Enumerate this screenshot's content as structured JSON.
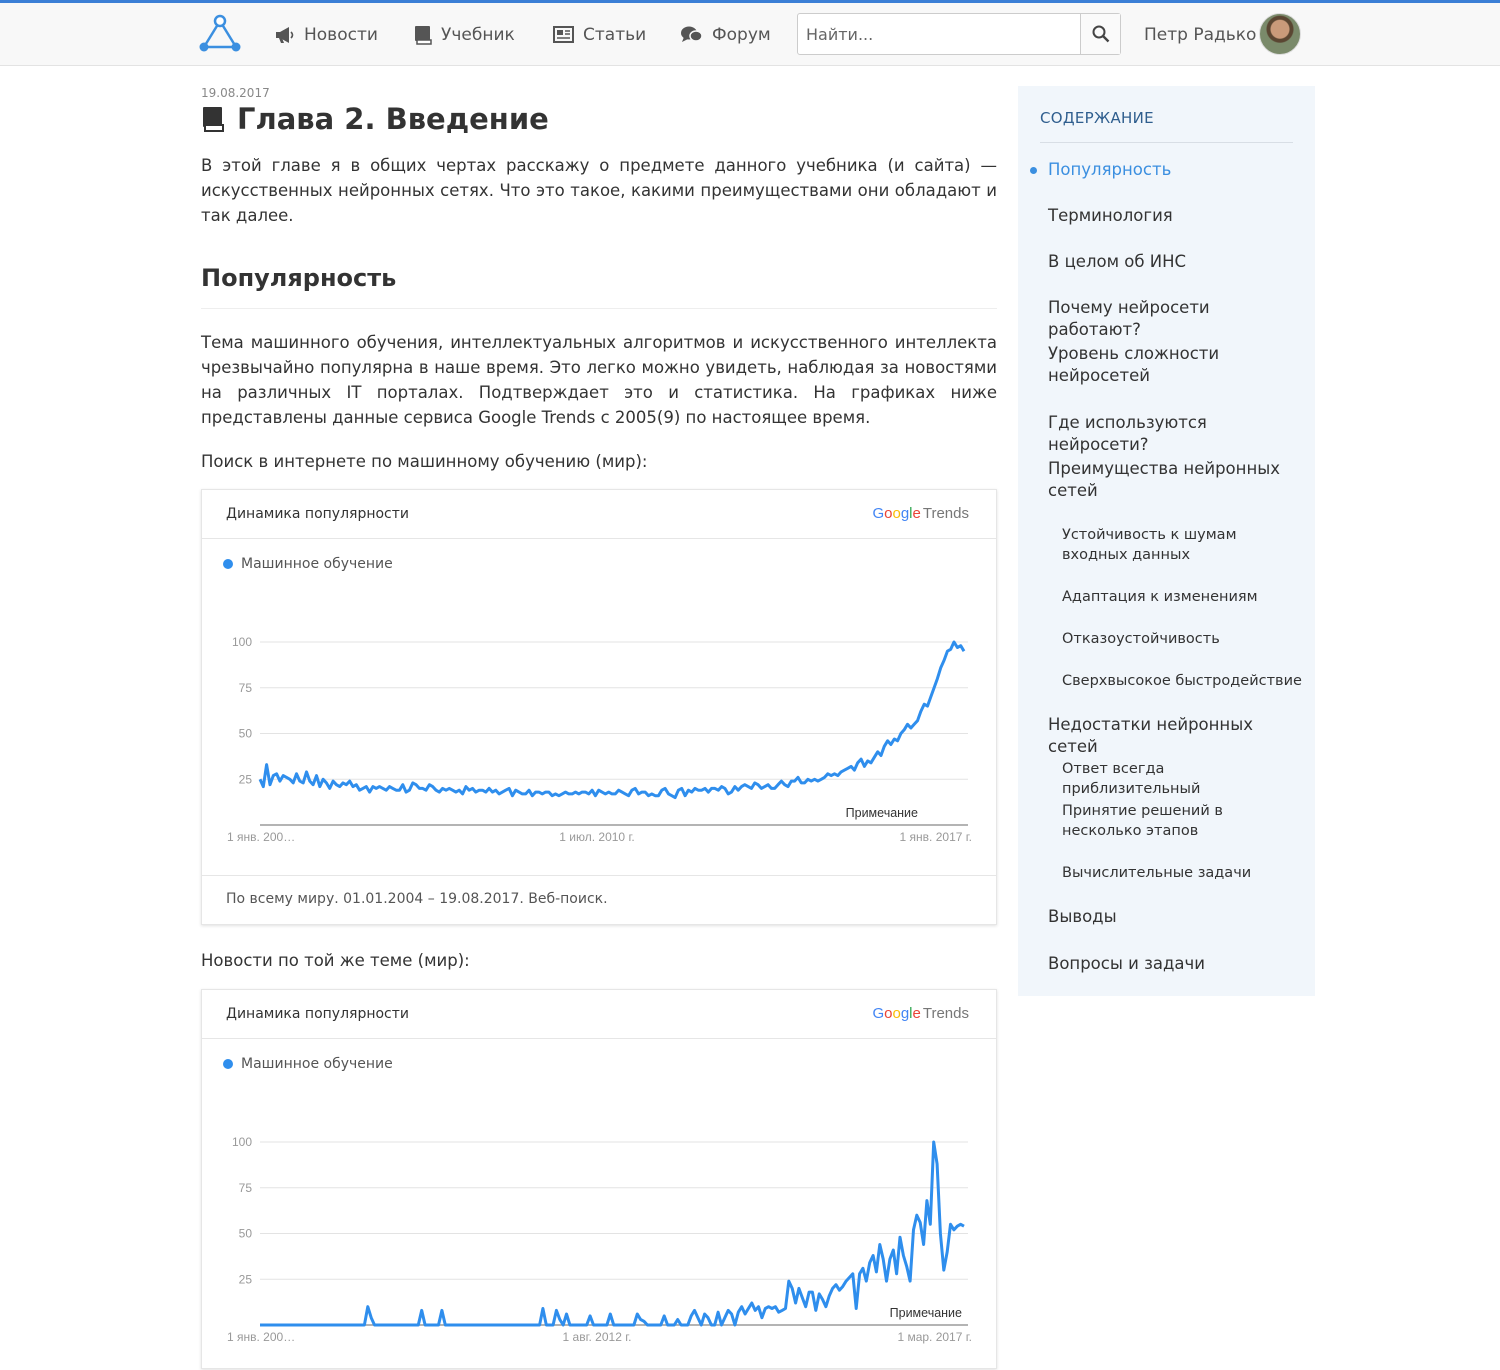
{
  "header": {
    "nav": [
      {
        "label": "Новости",
        "icon": "megaphone-icon"
      },
      {
        "label": "Учебник",
        "icon": "book-icon"
      },
      {
        "label": "Статьи",
        "icon": "newspaper-icon"
      },
      {
        "label": "Форум",
        "icon": "chat-bubbles-icon"
      }
    ],
    "search_placeholder": "Найти...",
    "user_name": "Петр Радько",
    "accent_color": "#3b7fd6"
  },
  "article": {
    "date": "19.08.2017",
    "title": "Глава 2. Введение",
    "intro": "В этой главе я в общих чертах расскажу о предмете данного учебника (и сайта) — искусственных нейронных сетях. Что это такое, какими преимуществами они обладают и так далее.",
    "section_title": "Популярность",
    "section_text": "Тема машинного обучения, интеллектуальных алгоритмов и искусственного интеллекта чрезвычайно популярна в наше время. Это легко можно увидеть, наблюдая за новостями на различных IT порталах. Подтверждает это и статистика. На графиках ниже представлены данные сервиса Google Trends с 2005(9) по настоящее время.",
    "caption1": "Поиск в интернете по машинному обучению (мир):",
    "caption2": "Новости по той же теме (мир):"
  },
  "trends_brand": {
    "google": [
      "G",
      "o",
      "o",
      "g",
      "l",
      "e"
    ],
    "trends": "Trends"
  },
  "chart_data": [
    {
      "type": "line",
      "card_title": "Динамика популярности",
      "series": [
        {
          "name": "Машинное обучение",
          "color": "#2f8eed",
          "values": [
            25,
            21,
            33,
            22,
            27,
            28,
            24,
            27,
            26,
            25,
            23,
            28,
            24,
            23,
            29,
            24,
            22,
            27,
            21,
            25,
            23,
            20,
            24,
            22,
            21,
            23,
            22,
            24,
            21,
            22,
            19,
            20,
            21,
            18,
            21,
            20,
            21,
            20,
            19,
            21,
            20,
            19,
            19,
            22,
            18,
            19,
            23,
            22,
            20,
            20,
            19,
            22,
            21,
            19,
            18,
            20,
            19,
            20,
            19,
            18,
            19,
            17,
            21,
            19,
            20,
            18,
            19,
            19,
            18,
            20,
            18,
            19,
            17,
            18,
            19,
            20,
            16,
            19,
            18,
            17,
            17,
            19,
            16,
            18,
            18,
            17,
            18,
            18,
            16,
            17,
            16,
            17,
            18,
            17,
            17,
            18,
            17,
            18,
            18,
            17,
            19,
            16,
            19,
            18,
            17,
            18,
            17,
            17,
            19,
            18,
            17,
            16,
            19,
            20,
            17,
            18,
            18,
            16,
            17,
            16,
            16,
            19,
            20,
            17,
            16,
            15,
            19,
            20,
            16,
            19,
            18,
            20,
            19,
            19,
            20,
            18,
            20,
            20,
            19,
            21,
            20,
            17,
            18,
            21,
            19,
            21,
            22,
            21,
            20,
            23,
            22,
            20,
            21,
            22,
            20,
            20,
            22,
            24,
            22,
            21,
            24,
            24,
            26,
            23,
            23,
            25,
            24,
            25,
            24,
            25,
            26,
            28,
            27,
            28,
            27,
            29,
            30,
            31,
            32,
            30,
            34,
            36,
            32,
            35,
            34,
            37,
            40,
            38,
            43,
            46,
            44,
            47,
            46,
            50,
            52,
            55,
            53,
            55,
            57,
            62,
            66,
            65,
            70,
            75,
            80,
            86,
            90,
            95,
            96,
            100,
            97,
            98,
            95
          ]
        }
      ],
      "yticks": [
        25,
        50,
        75,
        100
      ],
      "ylim": [
        0,
        100
      ],
      "x_tick_labels": [
        "1 янв. 200…",
        "1 июл. 2010 г.",
        "1 янв. 2017 г."
      ],
      "note": "Примечание",
      "footer": "По всему миру. 01.01.2004 – 19.08.2017. Веб-поиск."
    },
    {
      "type": "line",
      "card_title": "Динамика популярности",
      "series": [
        {
          "name": "Машинное обучение",
          "color": "#2f8eed",
          "values": [
            0,
            0,
            0,
            0,
            0,
            0,
            0,
            0,
            0,
            0,
            0,
            0,
            0,
            0,
            0,
            0,
            0,
            0,
            0,
            0,
            0,
            0,
            0,
            0,
            0,
            0,
            0,
            0,
            0,
            0,
            0,
            0,
            10,
            4,
            0,
            0,
            0,
            0,
            0,
            0,
            0,
            0,
            0,
            0,
            0,
            0,
            0,
            0,
            8,
            0,
            0,
            0,
            0,
            0,
            8,
            0,
            0,
            0,
            0,
            0,
            0,
            0,
            0,
            0,
            0,
            0,
            0,
            0,
            0,
            0,
            0,
            0,
            0,
            0,
            0,
            0,
            0,
            0,
            0,
            0,
            0,
            0,
            0,
            0,
            9,
            0,
            0,
            0,
            8,
            3,
            0,
            6,
            0,
            0,
            0,
            0,
            0,
            0,
            5,
            0,
            0,
            0,
            0,
            0,
            6,
            0,
            0,
            0,
            0,
            0,
            0,
            0,
            6,
            3,
            2,
            0,
            0,
            0,
            0,
            0,
            5,
            0,
            0,
            0,
            3,
            0,
            0,
            0,
            5,
            8,
            4,
            0,
            6,
            4,
            0,
            0,
            7,
            0,
            4,
            8,
            6,
            0,
            7,
            10,
            6,
            9,
            12,
            8,
            10,
            4,
            9,
            10,
            9,
            10,
            7,
            8,
            9,
            24,
            20,
            12,
            20,
            15,
            10,
            18,
            18,
            8,
            17,
            14,
            10,
            16,
            20,
            22,
            19,
            21,
            24,
            26,
            28,
            9,
            28,
            31,
            24,
            34,
            38,
            29,
            44,
            36,
            24,
            36,
            41,
            28,
            48,
            38,
            32,
            24,
            52,
            60,
            56,
            44,
            68,
            55,
            100,
            88,
            50,
            30,
            40,
            55,
            52,
            54,
            55,
            54
          ]
        }
      ],
      "yticks": [
        25,
        50,
        75,
        100
      ],
      "ylim": [
        0,
        100
      ],
      "x_tick_labels": [
        "1 янв. 200…",
        "1 авг. 2012 г.",
        "1 мар. 2017 г."
      ],
      "note": "Примечание"
    }
  ],
  "toc": {
    "heading": "СОДЕРЖАНИЕ",
    "items": [
      {
        "label": "Популярность",
        "sub": false,
        "active": true
      },
      {
        "label": "Терминология",
        "sub": false
      },
      {
        "label": "В целом об ИНС",
        "sub": false
      },
      {
        "label": "Почему нейросети работают?",
        "sub": false
      },
      {
        "label": "Уровень сложности нейросетей",
        "sub": false
      },
      {
        "label": "Где используются нейросети?",
        "sub": false
      },
      {
        "label": "Преимущества нейронных сетей",
        "sub": false
      },
      {
        "label": "Устойчивость к шумам входных данных",
        "sub": true
      },
      {
        "label": "Адаптация к изменениям",
        "sub": true
      },
      {
        "label": "Отказоустойчивость",
        "sub": true
      },
      {
        "label": "Сверхвысокое быстродействие",
        "sub": true
      },
      {
        "label": "Недостатки нейронных сетей",
        "sub": false
      },
      {
        "label": "Ответ всегда приблизительный",
        "sub": true
      },
      {
        "label": "Принятие решений в несколько этапов",
        "sub": true
      },
      {
        "label": "Вычислительные задачи",
        "sub": true
      },
      {
        "label": "Выводы",
        "sub": false
      },
      {
        "label": "Вопросы и задачи",
        "sub": false
      }
    ]
  }
}
